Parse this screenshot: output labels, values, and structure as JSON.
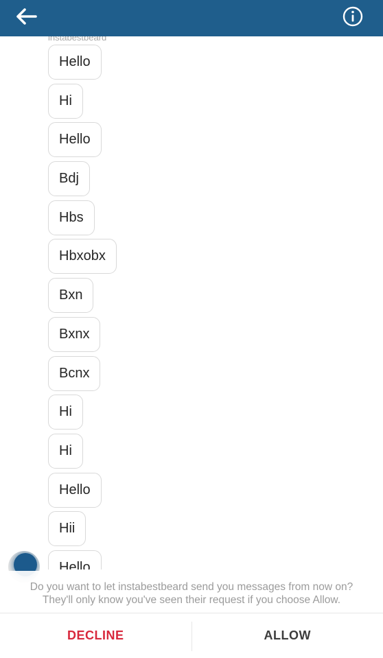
{
  "header": {
    "back_icon": "arrow-left-icon",
    "info_icon": "info-circle-icon",
    "bar_color": "#1f5e8c"
  },
  "thread": {
    "sender_name": "instabestbeard",
    "messages": [
      {
        "text": "Hello"
      },
      {
        "text": "Hi"
      },
      {
        "text": "Hello"
      },
      {
        "text": "Bdj"
      },
      {
        "text": "Hbs"
      },
      {
        "text": "Hbxobx"
      },
      {
        "text": "Bxn"
      },
      {
        "text": "Bxnx"
      },
      {
        "text": "Bcnx"
      },
      {
        "text": "Hi"
      },
      {
        "text": "Hi"
      },
      {
        "text": "Hello"
      },
      {
        "text": "Hii"
      },
      {
        "text": "Hello"
      }
    ]
  },
  "request": {
    "prompt_line1": "Do you want to let instabestbeard send you messages from now on?",
    "prompt_line2": "They'll only know you've seen their request if you choose Allow.",
    "decline_label": "DECLINE",
    "allow_label": "ALLOW",
    "decline_color": "#d8283c"
  }
}
